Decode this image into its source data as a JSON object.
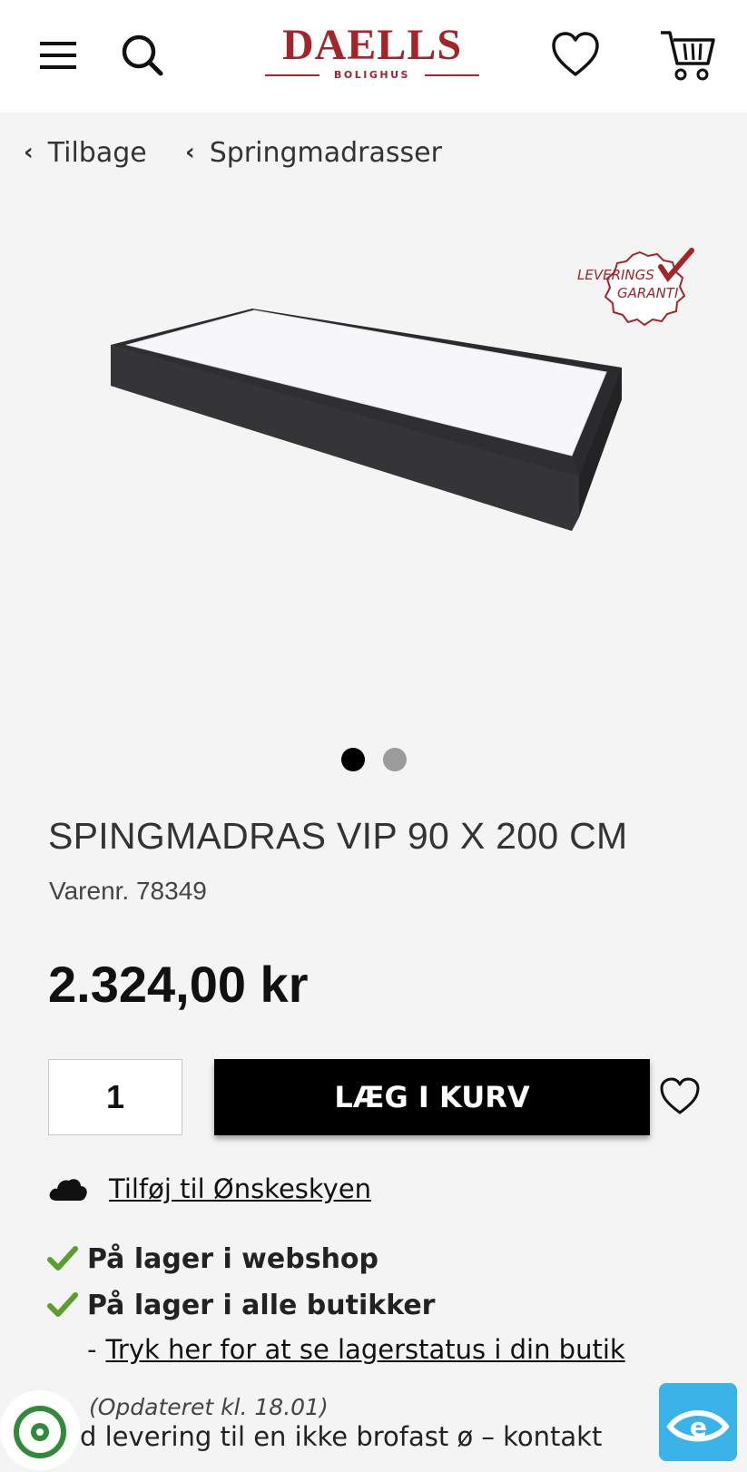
{
  "header": {
    "logo_main": "DAELLS",
    "logo_sub": "BOLIGHUS",
    "icons": [
      "menu-icon",
      "search-icon",
      "heart-icon",
      "cart-icon"
    ]
  },
  "breadcrumb": {
    "back_label": "Tilbage",
    "category_label": "Springmadrasser"
  },
  "badge": {
    "line1": "LEVERINGS",
    "line2": "GARANTI"
  },
  "carousel": {
    "total": 2,
    "active": 1
  },
  "product": {
    "title": "SPINGMADRAS VIP 90 X 200 CM",
    "sku": "Varenr. 78349",
    "price": "2.324,00 kr",
    "quantity": "1",
    "add_to_cart_label": "LÆG I KURV"
  },
  "wishlist": {
    "cloud_link": "Tilføj til Ønskeskyen"
  },
  "stock": {
    "webshop": "På lager i webshop",
    "stores": "På lager i alle butikker",
    "dash": "-",
    "store_link": "Tryk her for at se lagerstatus i din butik",
    "updated": "(Opdateret kl. 18.01)",
    "notice_partial": "d levering til en ikke brofast ø – kontakt"
  },
  "colors": {
    "brand": "#a3242b",
    "check": "#5a9e2b",
    "eye_badge": "#39b3e8"
  }
}
